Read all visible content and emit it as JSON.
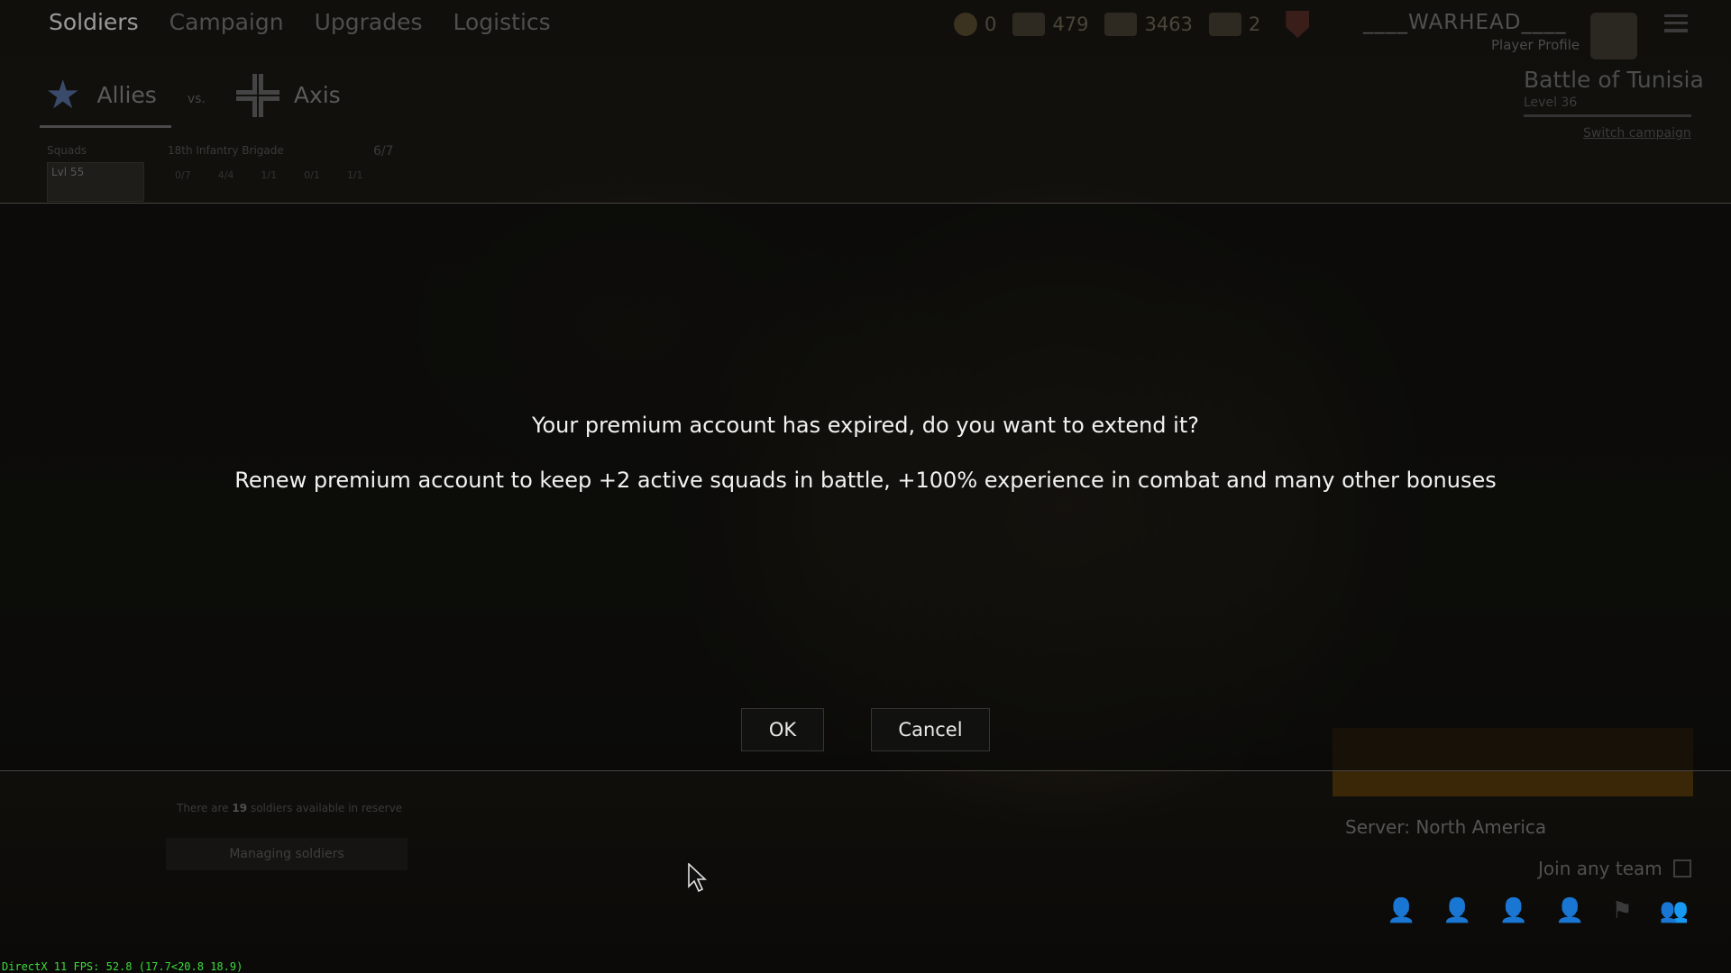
{
  "nav": {
    "tabs": [
      "Soldiers",
      "Campaign",
      "Upgrades",
      "Logistics"
    ],
    "active": "Soldiers"
  },
  "currencies": [
    {
      "icon": "gold-coin-icon",
      "value": "0"
    },
    {
      "icon": "silver-order-icon",
      "value": "479"
    },
    {
      "icon": "gold-order-icon",
      "value": "3463"
    },
    {
      "icon": "ticket-icon",
      "value": "2"
    }
  ],
  "player": {
    "name": "____WARHEAD____",
    "profile_label": "Player Profile"
  },
  "factions": {
    "allies": "Allies",
    "vs": "vs.",
    "axis": "Axis"
  },
  "squads": {
    "label": "Squads",
    "brigade": "18th Infantry Brigade",
    "count": "6/7",
    "card_level": "Lvl 55",
    "slots": [
      "0/7",
      "4/4",
      "1/1",
      "0/1",
      "1/1"
    ]
  },
  "campaign": {
    "name": "Battle of Tunisia",
    "level": "Level 36",
    "switch_label": "Switch campaign"
  },
  "reserve": {
    "prefix": "There are",
    "count": "19",
    "suffix": "soldiers available in reserve",
    "manage_label": "Managing soldiers"
  },
  "matchmaking": {
    "server": "Server: North America",
    "join_any_team": "Join any team"
  },
  "dialog": {
    "title": "Your premium account has expired, do you want to extend it?",
    "body": "Renew premium account to keep +2 active squads in battle, +100% experience in combat and many other bonuses",
    "ok_label": "OK",
    "cancel_label": "Cancel"
  },
  "debug": {
    "fps": "DirectX 11 FPS: 52.8 (17.7<20.8 18.9)"
  }
}
